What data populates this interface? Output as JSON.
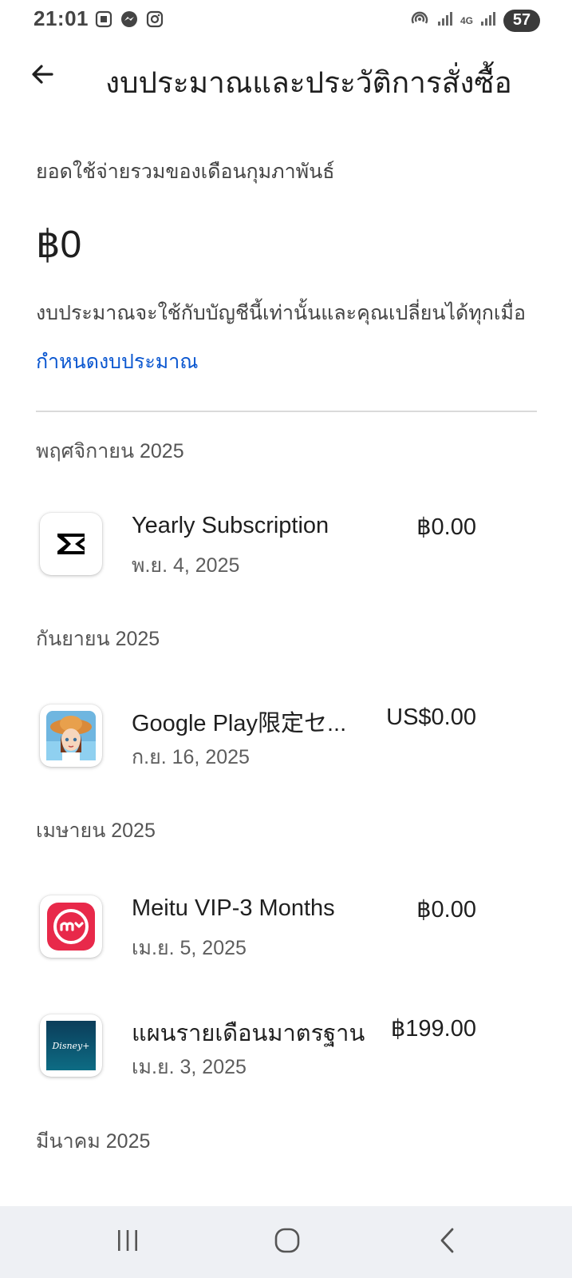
{
  "status_bar": {
    "time": "21:01",
    "network_type": "4G",
    "battery": "57",
    "left_icons": [
      "screenshot-icon",
      "messenger-icon",
      "instagram-icon"
    ],
    "right_icons": [
      "hotspot-icon",
      "signal-icon",
      "signal-icon"
    ]
  },
  "header": {
    "back_icon": "back-arrow-icon",
    "title": "งบประมาณและประวัติการสั่งซื้อ"
  },
  "summary": {
    "label": "ยอดใช้จ่ายรวมของเดือนกุมภาพันธ์",
    "amount": "฿0",
    "note": "งบประมาณจะใช้กับบัญชีนี้เท่านั้นและคุณเปลี่ยนได้ทุกเมื่อ",
    "set_budget_link": "กำหนดงบประมาณ"
  },
  "history": [
    {
      "month": "พฤศจิกายน 2025",
      "items": [
        {
          "icon": "capcut-app-icon",
          "title": "Yearly Subscription",
          "date": "พ.ย. 4, 2025",
          "price": "฿0.00"
        }
      ]
    },
    {
      "month": "กันยายน 2025",
      "items": [
        {
          "icon": "anime-game-app-icon",
          "title": "Google Play限定セ...",
          "date": "ก.ย. 16, 2025",
          "price": "US$0.00"
        }
      ]
    },
    {
      "month": "เมษายน 2025",
      "items": [
        {
          "icon": "meitu-app-icon",
          "title": "Meitu VIP-3 Months",
          "date": "เม.ย. 5, 2025",
          "price": "฿0.00"
        },
        {
          "icon": "disney-plus-app-icon",
          "title": "แผนรายเดือนมาตรฐาน",
          "date": "เม.ย. 3, 2025",
          "price": "฿199.00",
          "icon_text": "Disney+"
        }
      ]
    },
    {
      "month": "มีนาคม 2025",
      "items": []
    }
  ],
  "nav_bar": {
    "items": [
      "recent-apps-icon",
      "home-icon",
      "back-icon"
    ]
  },
  "colors": {
    "link": "#0b57d0",
    "meitu_red": "#e8294a",
    "disney_teal": "#0d6c84"
  }
}
